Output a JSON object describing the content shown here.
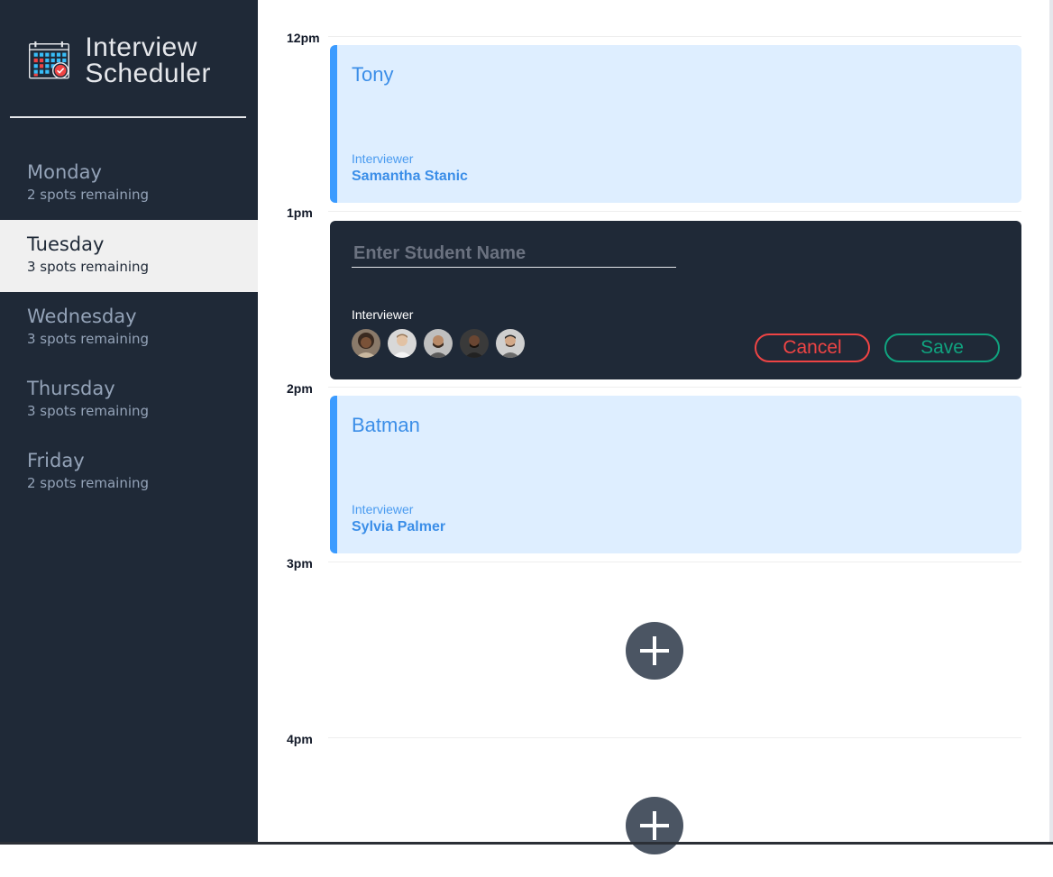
{
  "app": {
    "title": "Interview Scheduler"
  },
  "colors": {
    "sidebar_bg": "#1f2937",
    "selected_day_bg": "#f0f0f0",
    "appointment_bg": "#deeeff",
    "appointment_accent": "#3b9bff",
    "cancel": "#ef4444",
    "save": "#10a37f",
    "add_button": "#4b5563"
  },
  "days": [
    {
      "name": "Monday",
      "spots": "2 spots remaining",
      "selected": false
    },
    {
      "name": "Tuesday",
      "spots": "3 spots remaining",
      "selected": true
    },
    {
      "name": "Wednesday",
      "spots": "3 spots remaining",
      "selected": false
    },
    {
      "name": "Thursday",
      "spots": "3 spots remaining",
      "selected": false
    },
    {
      "name": "Friday",
      "spots": "2 spots remaining",
      "selected": false
    }
  ],
  "schedule": {
    "times": [
      "12pm",
      "1pm",
      "2pm",
      "3pm",
      "4pm"
    ],
    "appointments": [
      {
        "student": "Tony",
        "interviewer_label": "Interviewer",
        "interviewer": "Samantha Stanic"
      },
      {
        "student": "Batman",
        "interviewer_label": "Interviewer",
        "interviewer": "Sylvia Palmer"
      }
    ],
    "form": {
      "placeholder": "Enter Student Name",
      "interviewer_label": "Interviewer",
      "avatar_icons": [
        "interviewer-avatar",
        "interviewer-avatar",
        "interviewer-avatar",
        "interviewer-avatar",
        "interviewer-avatar"
      ],
      "cancel_label": "Cancel",
      "save_label": "Save"
    },
    "add_icon": "plus-icon"
  }
}
